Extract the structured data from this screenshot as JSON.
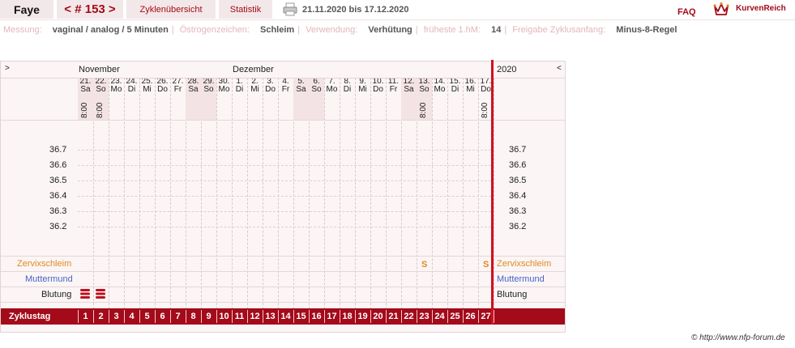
{
  "header": {
    "name": "Faye",
    "cycle_nav": "< # 153 >",
    "tab_overview": "Zyklenübersicht",
    "tab_stats": "Statistik",
    "date_range": "21.11.2020 bis 17.12.2020",
    "faq": "FAQ",
    "brand": "KurvenReich"
  },
  "info": {
    "messung_label": "Messung:",
    "messung_value": "vaginal / analog / 5 Minuten",
    "oestrogen_label": "Östrogenzeichen:",
    "oestrogen_value": "Schleim",
    "verwendung_label": "Verwendung:",
    "verwendung_value": "Verhütung",
    "fruehest_label": "früheste 1.hM:",
    "fruehest_value": "14",
    "freigabe_label": "Freigabe Zyklusanfang:",
    "freigabe_value": "Minus-8-Regel"
  },
  "chart": {
    "arrow_left": ">",
    "arrow_right": "<",
    "month_november": "November",
    "month_dezember": "Dezember",
    "year": "2020",
    "days": [
      {
        "d": "21.",
        "w": "Sa",
        "we": true,
        "time": "8:00",
        "blood": true
      },
      {
        "d": "22.",
        "w": "So",
        "we": true,
        "time": "8:00",
        "blood": true
      },
      {
        "d": "23.",
        "w": "Mo"
      },
      {
        "d": "24.",
        "w": "Di"
      },
      {
        "d": "25.",
        "w": "Mi"
      },
      {
        "d": "26.",
        "w": "Do"
      },
      {
        "d": "27.",
        "w": "Fr"
      },
      {
        "d": "28.",
        "w": "Sa",
        "we": true
      },
      {
        "d": "29.",
        "w": "So",
        "we": true
      },
      {
        "d": "30.",
        "w": "Mo"
      },
      {
        "d": "1.",
        "w": "Di"
      },
      {
        "d": "2.",
        "w": "Mi"
      },
      {
        "d": "3.",
        "w": "Do"
      },
      {
        "d": "4.",
        "w": "Fr"
      },
      {
        "d": "5.",
        "w": "Sa",
        "we": true
      },
      {
        "d": "6.",
        "w": "So",
        "we": true
      },
      {
        "d": "7.",
        "w": "Mo"
      },
      {
        "d": "8.",
        "w": "Di"
      },
      {
        "d": "9.",
        "w": "Mi"
      },
      {
        "d": "10.",
        "w": "Do"
      },
      {
        "d": "11.",
        "w": "Fr"
      },
      {
        "d": "12.",
        "w": "Sa",
        "we": true
      },
      {
        "d": "13.",
        "w": "So",
        "we": true,
        "time": "8:00",
        "mucus": "S"
      },
      {
        "d": "14.",
        "w": "Mo"
      },
      {
        "d": "15.",
        "w": "Di"
      },
      {
        "d": "16.",
        "w": "Mi"
      },
      {
        "d": "17.",
        "w": "Do",
        "time": "8:00",
        "mucus": "S"
      }
    ],
    "temps": [
      "36.7",
      "36.6",
      "36.5",
      "36.4",
      "36.3",
      "36.2"
    ],
    "row_cervix": "Zervixschleim",
    "row_mumu": "Muttermund",
    "row_blutung": "Blutung",
    "row_zyklustag": "Zyklustag",
    "cycle_days": [
      "1",
      "2",
      "3",
      "4",
      "5",
      "6",
      "7",
      "8",
      "9",
      "10",
      "11",
      "12",
      "13",
      "14",
      "15",
      "16",
      "17",
      "18",
      "19",
      "20",
      "21",
      "22",
      "23",
      "24",
      "25",
      "26",
      "27"
    ]
  },
  "footer": {
    "copyright": "© http://www.nfp-forum.de"
  },
  "colors": {
    "accent": "#a30a1a",
    "tab_bg": "#f3e8e9",
    "mucus": "#e08a1e",
    "muttermund": "#4a63c8",
    "today_line": "#d0101e"
  }
}
